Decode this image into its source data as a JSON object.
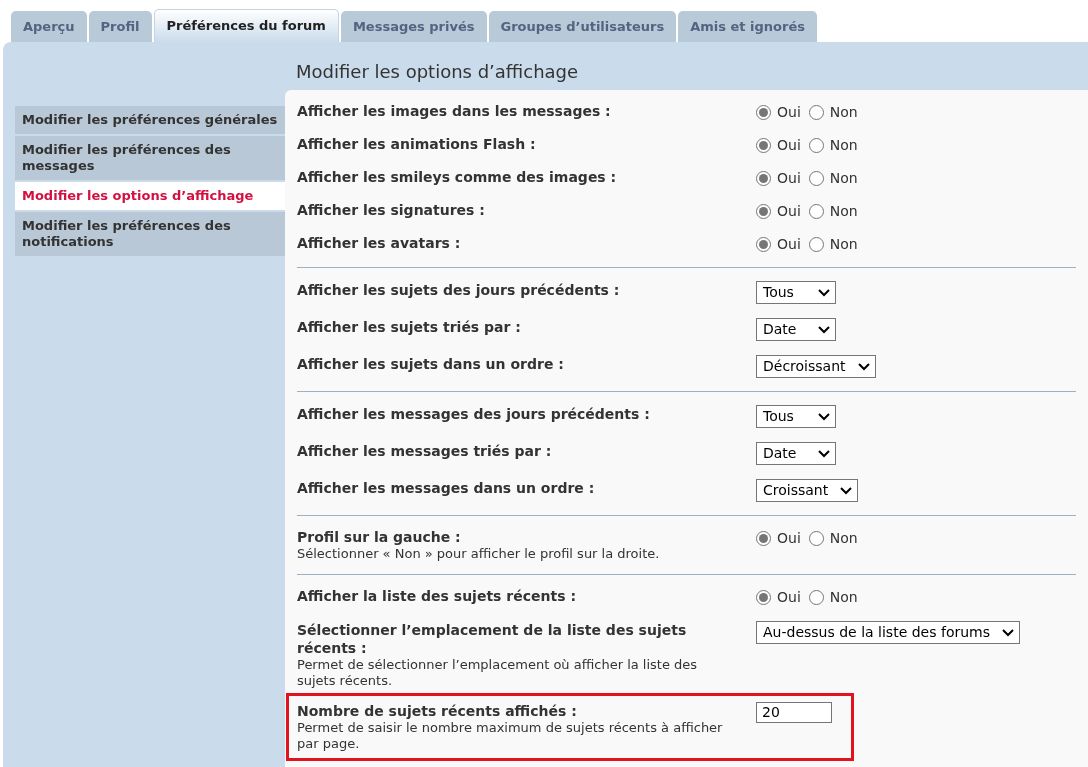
{
  "tabs": [
    {
      "label": "Aperçu",
      "selected": false
    },
    {
      "label": "Profil",
      "selected": false
    },
    {
      "label": "Préférences du forum",
      "selected": true
    },
    {
      "label": "Messages privés",
      "selected": false
    },
    {
      "label": "Groupes d’utilisateurs",
      "selected": false
    },
    {
      "label": "Amis et ignorés",
      "selected": false
    }
  ],
  "sidebar": {
    "items": [
      {
        "label": "Modifier les préférences générales",
        "selected": false
      },
      {
        "label": "Modifier les préférences des messages",
        "selected": false
      },
      {
        "label": "Modifier les options d’affichage",
        "selected": true
      },
      {
        "label": "Modifier les préférences des notifications",
        "selected": false
      }
    ]
  },
  "title": "Modifier les options d’affichage",
  "groups": [
    {
      "rows": [
        {
          "kind": "radio",
          "label": "Afficher les images dans les messages :",
          "options": [
            {
              "label": "Oui",
              "selected": true
            },
            {
              "label": "Non",
              "selected": false
            }
          ]
        },
        {
          "kind": "radio",
          "label": "Afficher les animations Flash :",
          "options": [
            {
              "label": "Oui",
              "selected": true
            },
            {
              "label": "Non",
              "selected": false
            }
          ]
        },
        {
          "kind": "radio",
          "label": "Afficher les smileys comme des images :",
          "options": [
            {
              "label": "Oui",
              "selected": true
            },
            {
              "label": "Non",
              "selected": false
            }
          ]
        },
        {
          "kind": "radio",
          "label": "Afficher les signatures :",
          "options": [
            {
              "label": "Oui",
              "selected": true
            },
            {
              "label": "Non",
              "selected": false
            }
          ]
        },
        {
          "kind": "radio",
          "label": "Afficher les avatars :",
          "options": [
            {
              "label": "Oui",
              "selected": true
            },
            {
              "label": "Non",
              "selected": false
            }
          ]
        }
      ]
    },
    {
      "rows": [
        {
          "kind": "select",
          "label": "Afficher les sujets des jours précédents :",
          "value": "Tous"
        },
        {
          "kind": "select",
          "label": "Afficher les sujets triés par :",
          "value": "Date"
        },
        {
          "kind": "select",
          "label": "Afficher les sujets dans un ordre :",
          "value": "Décroissant"
        }
      ]
    },
    {
      "rows": [
        {
          "kind": "select",
          "label": "Afficher les messages des jours précédents :",
          "value": "Tous"
        },
        {
          "kind": "select",
          "label": "Afficher les messages triés par :",
          "value": "Date"
        },
        {
          "kind": "select",
          "label": "Afficher les messages dans un ordre :",
          "value": "Croissant"
        }
      ]
    },
    {
      "rows": [
        {
          "kind": "radio",
          "label": "Profil sur la gauche :",
          "description": "Sélectionner « Non » pour afficher le profil sur la droite.",
          "options": [
            {
              "label": "Oui",
              "selected": true
            },
            {
              "label": "Non",
              "selected": false
            }
          ]
        }
      ]
    },
    {
      "rows": [
        {
          "kind": "radio",
          "label": "Afficher la liste des sujets récents :",
          "options": [
            {
              "label": "Oui",
              "selected": true
            },
            {
              "label": "Non",
              "selected": false
            }
          ]
        },
        {
          "kind": "select",
          "label": "Sélectionner l’emplacement de la liste des sujets récents :",
          "description": "Permet de sélectionner l’emplacement où afficher la liste des sujets récents.",
          "value": "Au-dessus de la liste des forums"
        },
        {
          "kind": "text",
          "label": "Nombre de sujets récents affichés :",
          "description": "Permet de saisir le nombre maximum de sujets récents à afficher par page.",
          "value": "20",
          "highlighted": true
        }
      ]
    }
  ]
}
